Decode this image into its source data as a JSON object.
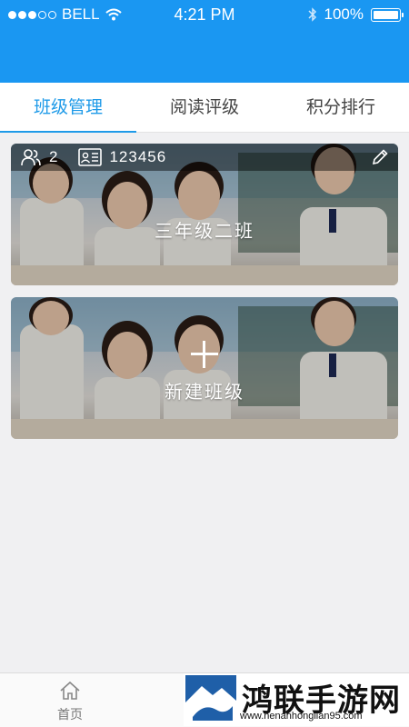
{
  "status_bar": {
    "carrier": "BELL",
    "time": "4:21 PM",
    "battery": "100%"
  },
  "tabs": [
    {
      "label": "班级管理",
      "active": true
    },
    {
      "label": "阅读评级",
      "active": false
    },
    {
      "label": "积分排行",
      "active": false
    }
  ],
  "class_card": {
    "member_count": "2",
    "class_code": "123456",
    "name": "三年级二班"
  },
  "new_class_card": {
    "label": "新建班级"
  },
  "bottom_nav": {
    "home_label": "首页"
  },
  "watermark": {
    "brand": "鸿联手游网",
    "url": "www.henanhonglian95.com"
  },
  "colors": {
    "header": "#1a97f2",
    "accent": "#1e9ae8"
  }
}
